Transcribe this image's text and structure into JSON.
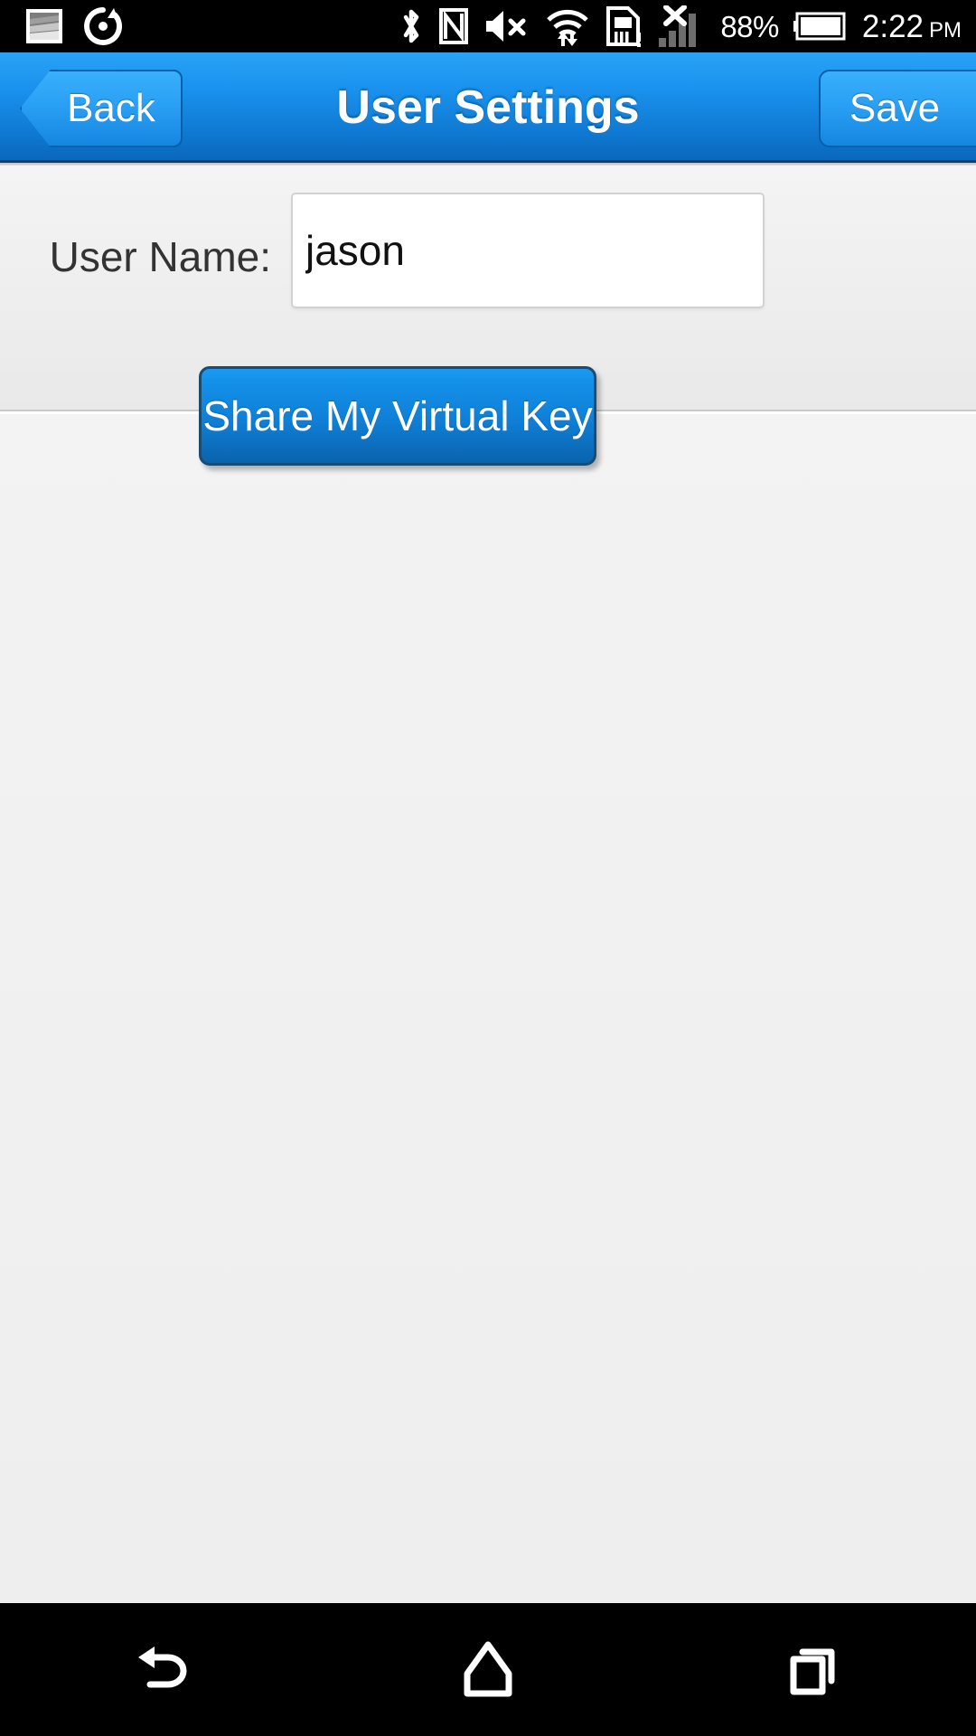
{
  "status_bar": {
    "left_icons": [
      {
        "name": "screenshot-notification-icon",
        "label": "screenshot"
      },
      {
        "name": "sync-rotate-icon",
        "label": "sync"
      }
    ],
    "right_icons": [
      {
        "name": "bluetooth-icon",
        "label": "bluetooth"
      },
      {
        "name": "nfc-icon",
        "label": "nfc"
      },
      {
        "name": "volume-mute-icon",
        "label": "volume-muted"
      },
      {
        "name": "wifi-icon",
        "label": "wifi-data-transfer"
      },
      {
        "name": "sim-card-alert-icon",
        "label": "sim-card-alert"
      },
      {
        "name": "signal-no-service-icon",
        "label": "no-signal"
      }
    ],
    "battery_percent": "88%",
    "time": "2:22",
    "am_pm": "PM"
  },
  "header": {
    "back_label": "Back",
    "title": "User Settings",
    "save_label": "Save"
  },
  "form": {
    "username_label": "User Name:",
    "username_value": "jason",
    "username_placeholder": ""
  },
  "actions": {
    "share_key_label": "Share My Virtual Key"
  },
  "nav_bar": {
    "back": "back-navigation",
    "home": "home-navigation",
    "recents": "recent-apps"
  },
  "colors": {
    "header_blue_top": "#29a3f5",
    "header_blue_bottom": "#0a68ba",
    "button_blue": "#0f7fd6",
    "page_background": "#f1f1f1",
    "status_bar": "#000000",
    "nav_bar": "#000000",
    "label_text": "#333333"
  }
}
